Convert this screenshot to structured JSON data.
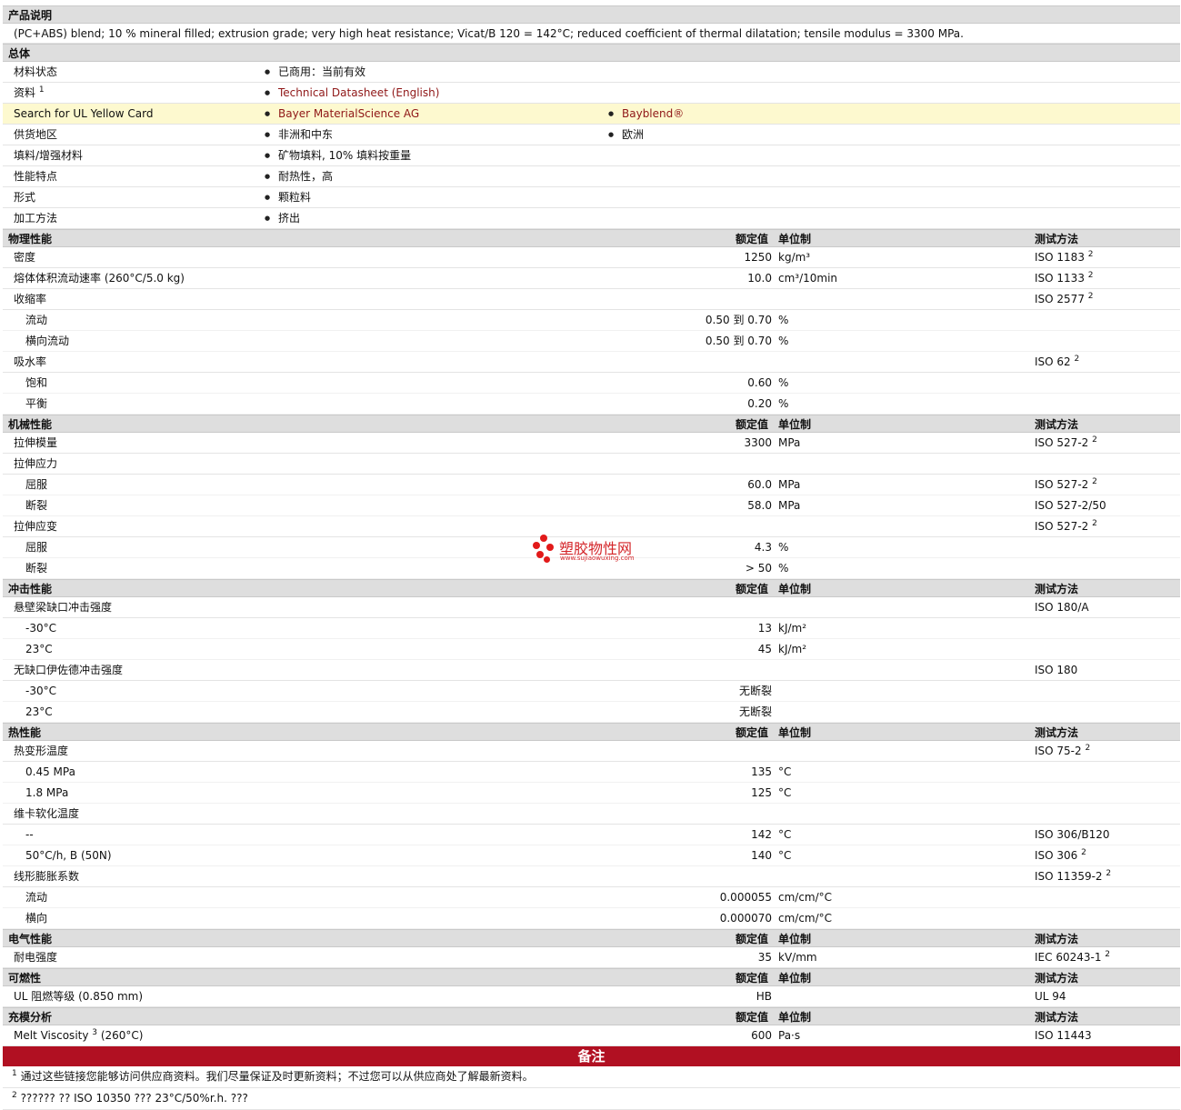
{
  "desc_title": "产品说明",
  "description": "(PC+ABS) blend; 10 % mineral filled; extrusion grade; very high heat resistance; Vicat/B 120 = 142°C; reduced coefficient of thermal dilatation; tensile modulus = 3300 MPa.",
  "general": {
    "title": "总体",
    "rows": [
      {
        "label": "材料状态",
        "sup": "",
        "items": [
          "已商用：当前有效"
        ],
        "link": false,
        "hl": false
      },
      {
        "label": "资料",
        "sup": "1",
        "items": [
          "Technical Datasheet (English)"
        ],
        "link": true,
        "hl": false
      },
      {
        "label": "Search for UL Yellow Card",
        "sup": "",
        "items": [
          "Bayer MaterialScience AG",
          "Bayblend®"
        ],
        "link": true,
        "hl": true
      },
      {
        "label": "供货地区",
        "sup": "",
        "items": [
          "非洲和中东",
          "欧洲"
        ],
        "link": false,
        "hl": false
      },
      {
        "label": "填料/增强材料",
        "sup": "",
        "items": [
          "矿物填料, 10% 填料按重量"
        ],
        "link": false,
        "hl": false
      },
      {
        "label": "性能特点",
        "sup": "",
        "items": [
          "耐热性，高"
        ],
        "link": false,
        "hl": false
      },
      {
        "label": "形式",
        "sup": "",
        "items": [
          "颗粒料"
        ],
        "link": false,
        "hl": false
      },
      {
        "label": "加工方法",
        "sup": "",
        "items": [
          "挤出"
        ],
        "link": false,
        "hl": false
      }
    ]
  },
  "col_headers": {
    "value": "额定值",
    "unit": "单位制",
    "method": "测试方法"
  },
  "sections": [
    {
      "title": "物理性能",
      "rows": [
        {
          "label": "密度",
          "sub": false,
          "value": "1250",
          "unit": "kg/m³",
          "method": "ISO 1183",
          "sup": "2"
        },
        {
          "label": "熔体体积流动速率  (260°C/5.0 kg)",
          "sub": false,
          "value": "10.0",
          "unit": "cm³/10min",
          "method": "ISO 1133",
          "sup": "2"
        },
        {
          "label": "收缩率",
          "sub": false,
          "value": "",
          "unit": "",
          "method": "ISO 2577",
          "sup": "2"
        },
        {
          "label": "流动",
          "sub": true,
          "value": "0.50 到  0.70",
          "unit": "%",
          "method": "",
          "sup": ""
        },
        {
          "label": "横向流动",
          "sub": true,
          "value": "0.50 到  0.70",
          "unit": "%",
          "method": "",
          "sup": ""
        },
        {
          "label": "吸水率",
          "sub": false,
          "value": "",
          "unit": "",
          "method": "ISO 62",
          "sup": "2"
        },
        {
          "label": "饱和",
          "sub": true,
          "value": "0.60",
          "unit": "%",
          "method": "",
          "sup": ""
        },
        {
          "label": "平衡",
          "sub": true,
          "value": "0.20",
          "unit": "%",
          "method": "",
          "sup": ""
        }
      ]
    },
    {
      "title": "机械性能",
      "rows": [
        {
          "label": "拉伸模量",
          "sub": false,
          "value": "3300",
          "unit": "MPa",
          "method": "ISO 527-2",
          "sup": "2"
        },
        {
          "label": "拉伸应力",
          "sub": false,
          "value": "",
          "unit": "",
          "method": "",
          "sup": ""
        },
        {
          "label": "屈服",
          "sub": true,
          "value": "60.0",
          "unit": "MPa",
          "method": "ISO 527-2",
          "sup": "2"
        },
        {
          "label": "断裂",
          "sub": true,
          "value": "58.0",
          "unit": "MPa",
          "method": "ISO 527-2/50",
          "sup": ""
        },
        {
          "label": "拉伸应变",
          "sub": false,
          "value": "",
          "unit": "",
          "method": "ISO 527-2",
          "sup": "2"
        },
        {
          "label": "屈服",
          "sub": true,
          "value": "4.3",
          "unit": "%",
          "method": "",
          "sup": ""
        },
        {
          "label": "断裂",
          "sub": true,
          "value": "> 50",
          "unit": "%",
          "method": "",
          "sup": ""
        }
      ]
    },
    {
      "title": "冲击性能",
      "rows": [
        {
          "label": "悬壁梁缺口冲击强度",
          "sub": false,
          "value": "",
          "unit": "",
          "method": "ISO 180/A",
          "sup": ""
        },
        {
          "label": "-30°C",
          "sub": true,
          "value": "13",
          "unit": "kJ/m²",
          "method": "",
          "sup": ""
        },
        {
          "label": "23°C",
          "sub": true,
          "value": "45",
          "unit": "kJ/m²",
          "method": "",
          "sup": ""
        },
        {
          "label": "无缺口伊佐德冲击强度",
          "sub": false,
          "value": "",
          "unit": "",
          "method": "ISO 180",
          "sup": ""
        },
        {
          "label": "-30°C",
          "sub": true,
          "value": "无断裂",
          "unit": "",
          "method": "",
          "sup": ""
        },
        {
          "label": "23°C",
          "sub": true,
          "value": "无断裂",
          "unit": "",
          "method": "",
          "sup": ""
        }
      ]
    },
    {
      "title": "热性能",
      "rows": [
        {
          "label": "热变形温度",
          "sub": false,
          "value": "",
          "unit": "",
          "method": "ISO 75-2",
          "sup": "2"
        },
        {
          "label": "0.45 MPa",
          "sub": true,
          "value": "135",
          "unit": "°C",
          "method": "",
          "sup": ""
        },
        {
          "label": "1.8 MPa",
          "sub": true,
          "value": "125",
          "unit": "°C",
          "method": "",
          "sup": ""
        },
        {
          "label": "维卡软化温度",
          "sub": false,
          "value": "",
          "unit": "",
          "method": "",
          "sup": ""
        },
        {
          "label": "--",
          "sub": true,
          "value": "142",
          "unit": "°C",
          "method": "ISO 306/B120",
          "sup": ""
        },
        {
          "label": "50°C/h, B (50N)",
          "sub": true,
          "value": "140",
          "unit": "°C",
          "method": "ISO 306",
          "sup": "2"
        },
        {
          "label": "线形膨胀系数",
          "sub": false,
          "value": "",
          "unit": "",
          "method": "ISO 11359-2",
          "sup": "2"
        },
        {
          "label": "流动",
          "sub": true,
          "value": "0.000055",
          "unit": "cm/cm/°C",
          "method": "",
          "sup": ""
        },
        {
          "label": "横向",
          "sub": true,
          "value": "0.000070",
          "unit": "cm/cm/°C",
          "method": "",
          "sup": ""
        }
      ]
    },
    {
      "title": "电气性能",
      "rows": [
        {
          "label": "耐电强度",
          "sub": false,
          "value": "35",
          "unit": "kV/mm",
          "method": "IEC 60243-1",
          "sup": "2"
        }
      ]
    },
    {
      "title": "可燃性",
      "rows": [
        {
          "label": "UL 阻燃等级  (0.850 mm)",
          "sub": false,
          "value": "HB",
          "unit": "",
          "method": "UL 94",
          "sup": ""
        }
      ]
    },
    {
      "title": "充模分析",
      "rows": [
        {
          "label": "Melt Viscosity",
          "labelsup": "3",
          "labelsuffix": " (260°C)",
          "sub": false,
          "value": "600",
          "unit": "Pa·s",
          "method": "ISO 11443",
          "sup": ""
        }
      ]
    }
  ],
  "notes": {
    "title": "备注",
    "items": [
      {
        "num": "1",
        "text": "通过这些链接您能够访问供应商资料。我们尽量保证及时更新资料；不过您可以从供应商处了解最新资料。"
      },
      {
        "num": "2",
        "text": "?????? ?? ISO 10350 ??? 23°C/50%r.h. ???"
      }
    ]
  },
  "watermark": {
    "text": "塑胶物性网",
    "sub": "www.sujiaowuxing.com",
    "color": "#d4262a"
  }
}
